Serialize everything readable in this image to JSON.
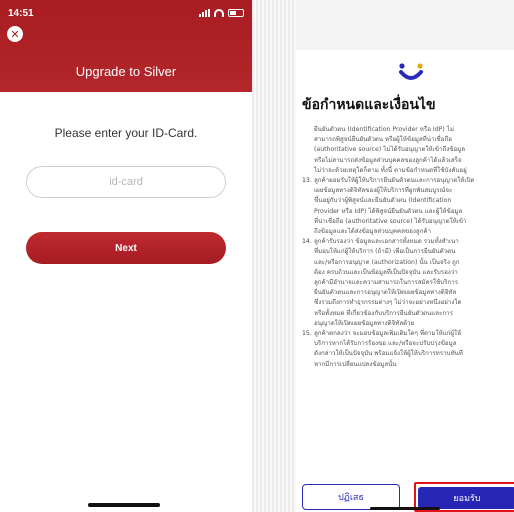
{
  "left": {
    "status": {
      "time": "14:51"
    },
    "title": "Upgrade to Silver",
    "prompt": "Please enter your ID-Card.",
    "input_placeholder": "id-card",
    "next_label": "Next",
    "brand_color": "#a81d22"
  },
  "right": {
    "title": "ข้อกำหนดและเงื่อนไข",
    "terms_lines": [
      "ยืนยันตัวตน (Identification Provider หรือ IdP) ไม่",
      "สามารถพิสูจน์ยืนยันตัวตน หรือผู้ให้ข้อมูลที่น่าเชื่อถือ",
      "(authoritative source) ไม่ได้รับอนุญาตให้เข้าถึงข้อมูล",
      "หรือไม่สามารถส่งข้อมูลส่วนบุคคลของลูกค้าได้แล้วเสร็จ",
      "ไม่ว่าจะด้วยเหตุใดก็ตาม ทั้งนี้ ตามข้อกำหนดที่ใช้บังคับอยู่"
    ],
    "item13_num": "13.",
    "item13_lines": [
      "ลูกค้ายอมรับให้ผู้ให้บริการยืนยันตัวตนและการอนุญาตให้เปิด",
      "เผยข้อมูลทางดิจิทัลของผู้ให้บริการที่ผูกพันสมบูรณ์จะ",
      "ขึ้นอยู่กับว่าผู้พิสูจน์และยืนยันตัวตน (Identification",
      "Provider หรือ IdP) ได้พิสูจน์ยืนยันตัวตน และผู้ให้ข้อมูล",
      "ที่น่าเชื่อถือ (authoritative source) ได้รับอนุญาตให้เข้า",
      "ถึงข้อมูลและได้ส่งข้อมูลส่วนบุคคลของลูกค้า"
    ],
    "item14_num": "14.",
    "item14_lines": [
      "ลูกค้ารับรองว่า ข้อมูลและเอกสารทั้งหมด รวมทั้งสำเนา",
      "ที่มอบให้แก่ผู้ให้บริการ (ถ้ามี) เพื่อเป็นการยืนยันตัวตน",
      "และ/หรือการอนุญาต (authorization) นั้น เป็นจริง ถูก",
      "ต้อง ครบถ้วนและเป็นข้อมูลที่เป็นปัจจุบัน และรับรองว่า",
      "ลูกค้ามีอำนาจและความสามารถในการสมัครใช้บริการ",
      "ยืนยันตัวตนและการอนุญาตให้เปิดเผยข้อมูลทางดิจิทัล",
      "ซึ่งรวมถึงการทำธุรกรรมต่างๆ ไม่ว่าจะอย่างหนึ่งอย่างใด",
      "หรือทั้งหมด ที่เกี่ยวข้องกับบริการยืนยันตัวตนและการ",
      "อนุญาตให้เปิดเผยข้อมูลทางดิจิทัลด้วย"
    ],
    "item15_num": "15.",
    "item15_lines": [
      "ลูกค้าตกลงว่า จะมอบข้อมูลเพิ่มเติมใดๆ ที่ตามให้แก่ผู้ให้",
      "บริการหากได้รับการร้องขอ และ/หรือจะปรับปรุงข้อมูล",
      "ดังกล่าวให้เป็นปัจจุบัน พร้อมแจ้งให้ผู้ให้บริการทราบทันที",
      "หากมีการเปลี่ยนแปลงข้อมูลนั้น"
    ],
    "decline_label": "ปฏิเสธ",
    "accept_label": "ยอมรับ",
    "accent_color": "#2727b5",
    "highlight_color": "#e3131b"
  }
}
